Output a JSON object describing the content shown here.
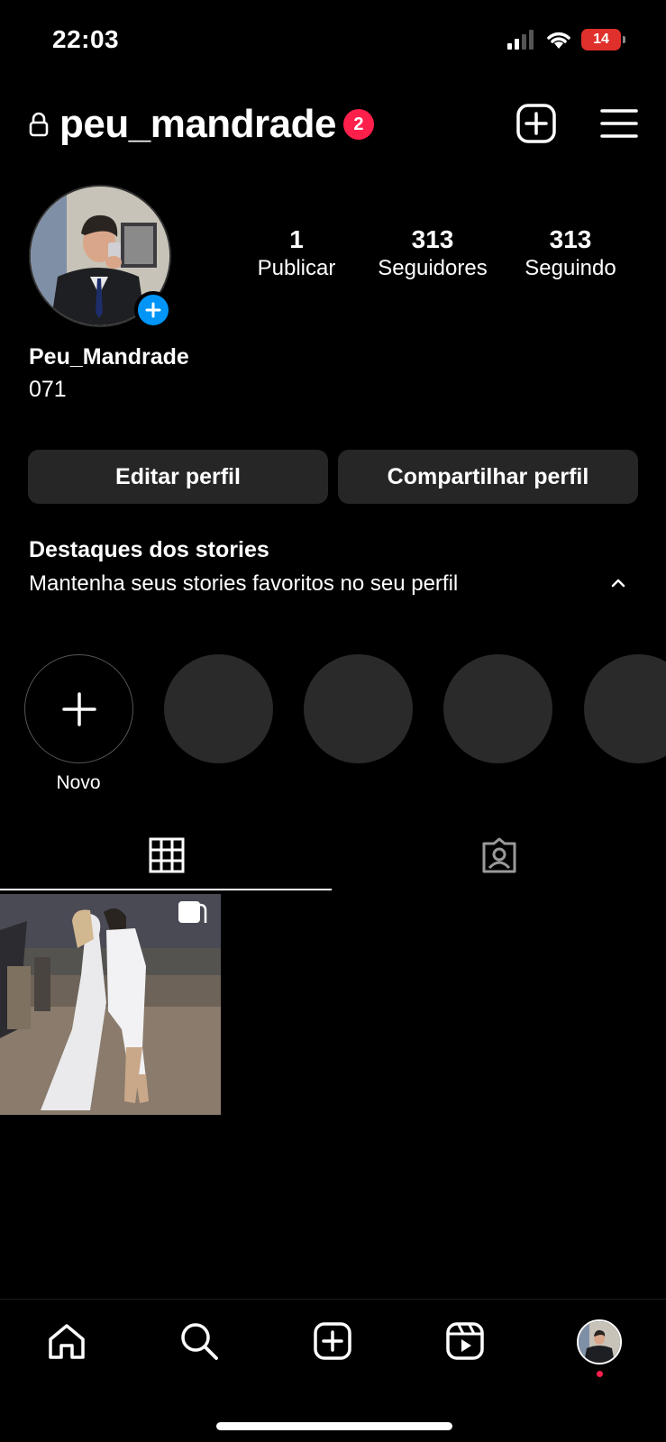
{
  "status_bar": {
    "time": "22:03",
    "battery": "14"
  },
  "header": {
    "username": "peu_mandrade",
    "notification_count": "2"
  },
  "stats": [
    {
      "value": "1",
      "label": "Publicar"
    },
    {
      "value": "313",
      "label": "Seguidores"
    },
    {
      "value": "313",
      "label": "Seguindo"
    }
  ],
  "profile": {
    "display_name": "Peu_Mandrade",
    "bio": "071"
  },
  "buttons": {
    "edit": "Editar perfil",
    "share": "Compartilhar perfil"
  },
  "highlights": {
    "title": "Destaques dos stories",
    "description": "Mantenha seus stories favoritos no seu perfil",
    "new_label": "Novo"
  },
  "colors": {
    "accent_blue": "#0095f6",
    "badge_red": "#ff1f4b",
    "button_bg": "#262626",
    "placeholder": "#2a2a2a"
  },
  "icons": [
    "lock-icon",
    "plus-square-icon",
    "menu-icon",
    "chevron-up-icon",
    "grid-icon",
    "tagged-icon",
    "carousel-icon",
    "home-icon",
    "search-icon",
    "create-icon",
    "reels-icon"
  ]
}
